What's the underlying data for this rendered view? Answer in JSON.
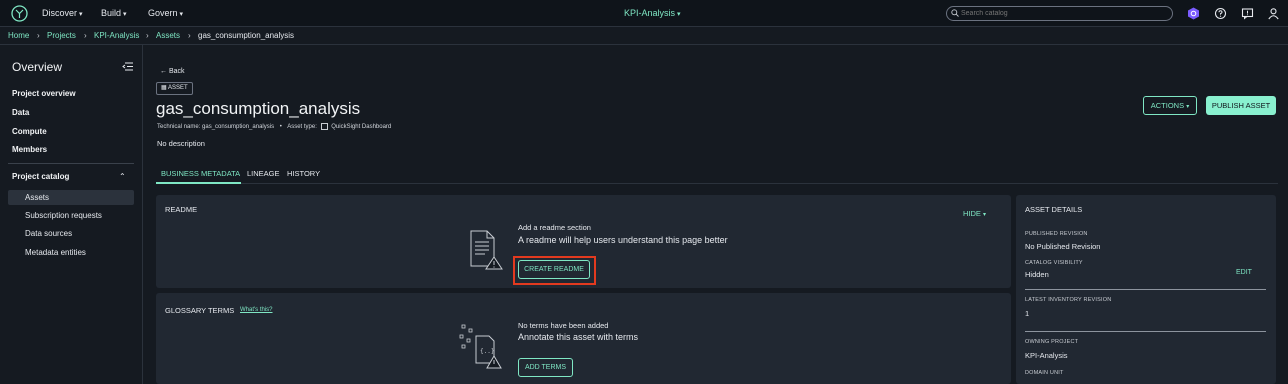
{
  "topnav": {
    "items": [
      {
        "label": "Discover"
      },
      {
        "label": "Build"
      },
      {
        "label": "Govern"
      }
    ],
    "project_switcher": "KPI-Analysis",
    "search_placeholder": "Search catalog"
  },
  "breadcrumb": [
    "Home",
    "Projects",
    "KPI-Analysis",
    "Assets",
    "gas_consumption_analysis"
  ],
  "sidebar": {
    "title": "Overview",
    "top_links": [
      "Project overview",
      "Data",
      "Compute",
      "Members"
    ],
    "catalog_section": "Project catalog",
    "catalog_items": [
      "Assets",
      "Subscription requests",
      "Data sources",
      "Metadata entities"
    ]
  },
  "asset": {
    "back_label": "Back",
    "tag": "ASSET",
    "title": "gas_consumption_analysis",
    "technical_name_label": "Technical name:",
    "technical_name": "gas_consumption_analysis",
    "asset_type_label": "Asset type:",
    "asset_type": "QuickSight Dashboard",
    "description": "No description",
    "actions_label": "ACTIONS",
    "publish_label": "PUBLISH ASSET"
  },
  "tabs": [
    "BUSINESS METADATA",
    "LINEAGE",
    "HISTORY"
  ],
  "readme": {
    "heading": "README",
    "hide_label": "HIDE",
    "line1": "Add a readme section",
    "line2": "A readme will help users understand this page better",
    "button": "CREATE README"
  },
  "glossary": {
    "heading": "GLOSSARY TERMS",
    "whats_this": "What's this?",
    "line1": "No terms have been added",
    "line2": "Annotate this asset with terms",
    "button": "ADD TERMS"
  },
  "details": {
    "heading": "ASSET DETAILS",
    "published_revision_label": "PUBLISHED REVISION",
    "published_revision": "No Published Revision",
    "catalog_visibility_label": "CATALOG VISIBILITY",
    "catalog_visibility": "Hidden",
    "edit_label": "EDIT",
    "inventory_revision_label": "LATEST INVENTORY REVISION",
    "inventory_revision": "1",
    "owning_project_label": "OWNING PROJECT",
    "owning_project": "KPI-Analysis",
    "domain_unit_label": "DOMAIN UNIT"
  },
  "colors": {
    "accent": "#7fe7c4",
    "highlight_box": "#e33a1f",
    "background": "#151a21",
    "panel": "#212832"
  }
}
